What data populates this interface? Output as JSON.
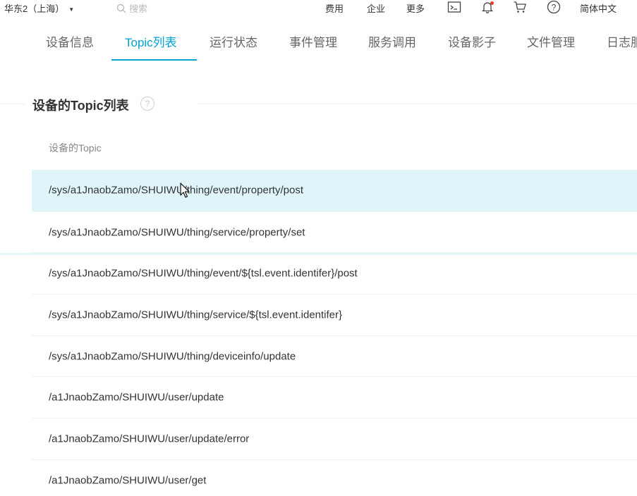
{
  "topbar": {
    "region_label": "华东2（上海）",
    "search_placeholder": "搜索",
    "links": {
      "billing": "费用",
      "enterprise": "企业",
      "more": "更多",
      "language": "简体中文"
    },
    "icons": [
      "terminal-icon",
      "bell-icon",
      "cart-icon",
      "help-circle-icon"
    ]
  },
  "tabs": [
    {
      "label": "设备信息",
      "active": false
    },
    {
      "label": "Topic列表",
      "active": true
    },
    {
      "label": "运行状态",
      "active": false
    },
    {
      "label": "事件管理",
      "active": false
    },
    {
      "label": "服务调用",
      "active": false
    },
    {
      "label": "设备影子",
      "active": false
    },
    {
      "label": "文件管理",
      "active": false
    },
    {
      "label": "日志服",
      "active": false
    }
  ],
  "section": {
    "title": "设备的Topic列表",
    "help": "?",
    "column_header": "设备的Topic"
  },
  "topics": [
    "/sys/a1JnaobZamo/SHUIWU/thing/event/property/post",
    "/sys/a1JnaobZamo/SHUIWU/thing/service/property/set",
    "/sys/a1JnaobZamo/SHUIWU/thing/event/${tsl.event.identifer}/post",
    "/sys/a1JnaobZamo/SHUIWU/thing/service/${tsl.event.identifer}",
    "/sys/a1JnaobZamo/SHUIWU/thing/deviceinfo/update",
    "/a1JnaobZamo/SHUIWU/user/update",
    "/a1JnaobZamo/SHUIWU/user/update/error",
    "/a1JnaobZamo/SHUIWU/user/get"
  ],
  "colors": {
    "accent": "#00a3cf",
    "hover_row": "#dff5f9",
    "notification_dot": "#e5382f"
  }
}
